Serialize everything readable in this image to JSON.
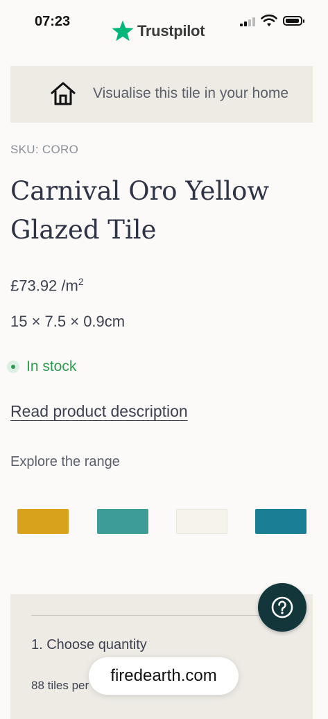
{
  "status_bar": {
    "time": "07:23"
  },
  "header": {
    "brand": "Trustpilot",
    "brand_color": "#00b67a"
  },
  "visualise": {
    "label": "Visualise this tile in your home",
    "icon": "home-icon"
  },
  "product": {
    "sku": "SKU: CORO",
    "title": "Carnival Oro Yellow Glazed Tile",
    "price": "£73.92 /m",
    "price_unit_sup": "2",
    "dimensions": "15 × 7.5 × 0.9cm",
    "stock_status": "In stock",
    "stock_color": "#2e9a4f",
    "description_link": "Read product description"
  },
  "range": {
    "heading": "Explore the range",
    "swatches": [
      {
        "name": "yellow-tile",
        "color": "#d9a21b"
      },
      {
        "name": "turquoise-tile",
        "color": "#3d9c95"
      },
      {
        "name": "white-tile",
        "color": "#f5f3ea"
      },
      {
        "name": "teal-tile",
        "color": "#1a7f94"
      }
    ]
  },
  "purchase": {
    "step": "1. Choose quantity",
    "tiles_per": "88 tiles per"
  },
  "help_button": {
    "icon": "question-icon"
  },
  "browser": {
    "url": "firedearth.com"
  }
}
